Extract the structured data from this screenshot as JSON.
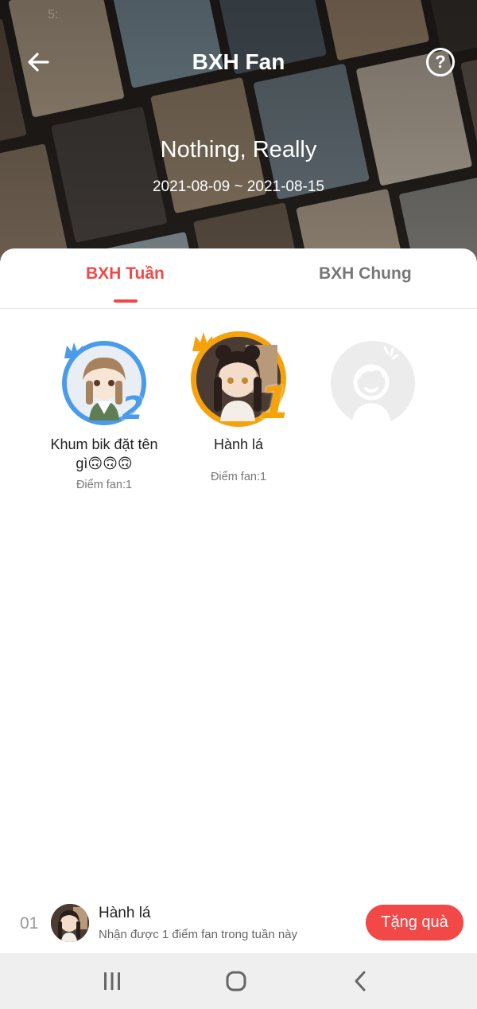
{
  "header": {
    "status_text": "5:",
    "title": "BXH Fan",
    "song_title": "Nothing, Really",
    "date_range": "2021-08-09 ~ 2021-08-15"
  },
  "icons": {
    "back": "arrow-left-icon",
    "help": "question-circle-icon",
    "help_glyph": "?"
  },
  "tabs": [
    {
      "label": "BXH Tuần",
      "active": true
    },
    {
      "label": "BXH Chung",
      "active": false
    }
  ],
  "podium": [
    {
      "rank": "2",
      "name": "Khum bik đặt tên gì🙃🙃🙃",
      "score": "Điểm fan:1",
      "ring_color": "#4a9bea"
    },
    {
      "rank": "1",
      "name": "Hành lá",
      "score": "Điểm fan:1",
      "ring_color": "#f6a20c"
    }
  ],
  "current_user": {
    "rank": "01",
    "name": "Hành lá",
    "description": "Nhận được 1 điểm fan trong tuần này",
    "gift_button": "Tặng quà"
  },
  "colors": {
    "accent": "#f24848",
    "tab_inactive": "#777777"
  },
  "navbar": {
    "recents_icon": "recent-apps-icon",
    "home_icon": "home-icon",
    "back_icon": "back-chevron-icon"
  }
}
